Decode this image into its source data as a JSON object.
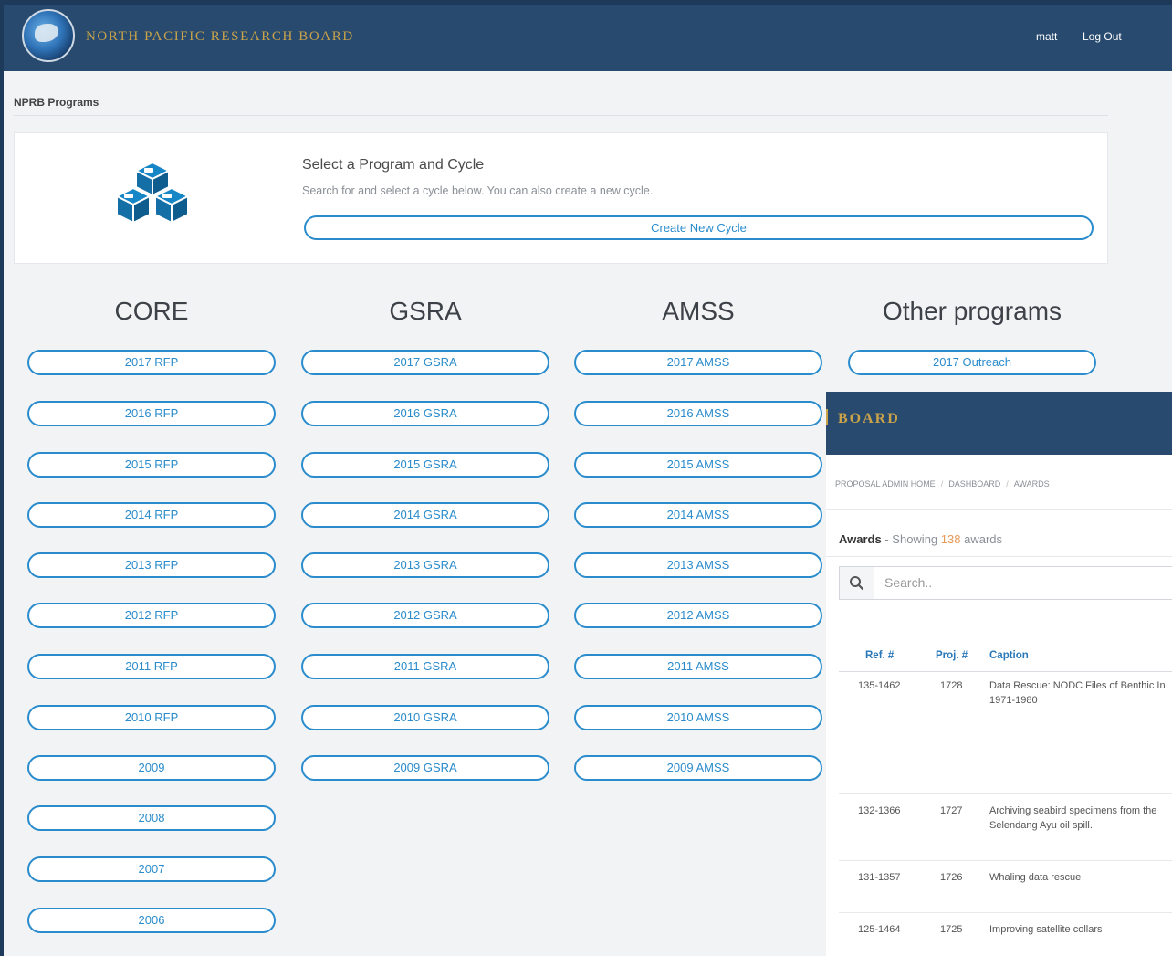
{
  "header": {
    "brand": "NORTH PACIFIC RESEARCH BOARD",
    "user": "matt",
    "logout": "Log Out"
  },
  "breadcrumb": "NPRB Programs",
  "panel": {
    "title": "Select a Program and Cycle",
    "subtitle": "Search for and select a cycle below. You can also create a new cycle.",
    "create_button": "Create New Cycle",
    "icon": "cubes-icon"
  },
  "programs": [
    {
      "title": "CORE",
      "cycles": [
        "2017 RFP",
        "2016 RFP",
        "2015 RFP",
        "2014 RFP",
        "2013 RFP",
        "2012 RFP",
        "2011 RFP",
        "2010 RFP",
        "2009",
        "2008",
        "2007",
        "2006"
      ]
    },
    {
      "title": "GSRA",
      "cycles": [
        "2017 GSRA",
        "2016 GSRA",
        "2015 GSRA",
        "2014 GSRA",
        "2013 GSRA",
        "2012 GSRA",
        "2011 GSRA",
        "2010 GSRA",
        "2009 GSRA"
      ]
    },
    {
      "title": "AMSS",
      "cycles": [
        "2017 AMSS",
        "2016 AMSS",
        "2015 AMSS",
        "2014 AMSS",
        "2013 AMSS",
        "2012 AMSS",
        "2011 AMSS",
        "2010 AMSS",
        "2009 AMSS"
      ]
    },
    {
      "title": "Other programs",
      "cycles": [
        "2017 Outreach"
      ]
    }
  ],
  "overlay": {
    "brand_fragment": "BOARD",
    "crumbs": [
      "PROPOSAL ADMIN HOME",
      "DASHBOARD",
      "AWARDS"
    ],
    "awards_label": "Awards",
    "awards_showing": " - Showing ",
    "awards_count": "138",
    "awards_suffix": " awards",
    "search_placeholder": "Search..",
    "columns": [
      "Ref. #",
      "Proj. #",
      "Caption"
    ],
    "rows": [
      {
        "ref": "135-1462",
        "proj": "1728",
        "caption": "Data Rescue: NODC Files of Benthic In 1971-1980"
      },
      {
        "ref": "132-1366",
        "proj": "1727",
        "caption": "Archiving seabird specimens from the Selendang Ayu oil spill."
      },
      {
        "ref": "131-1357",
        "proj": "1726",
        "caption": "Whaling data rescue"
      },
      {
        "ref": "125-1464",
        "proj": "1725",
        "caption": "Improving satellite collars"
      }
    ]
  }
}
